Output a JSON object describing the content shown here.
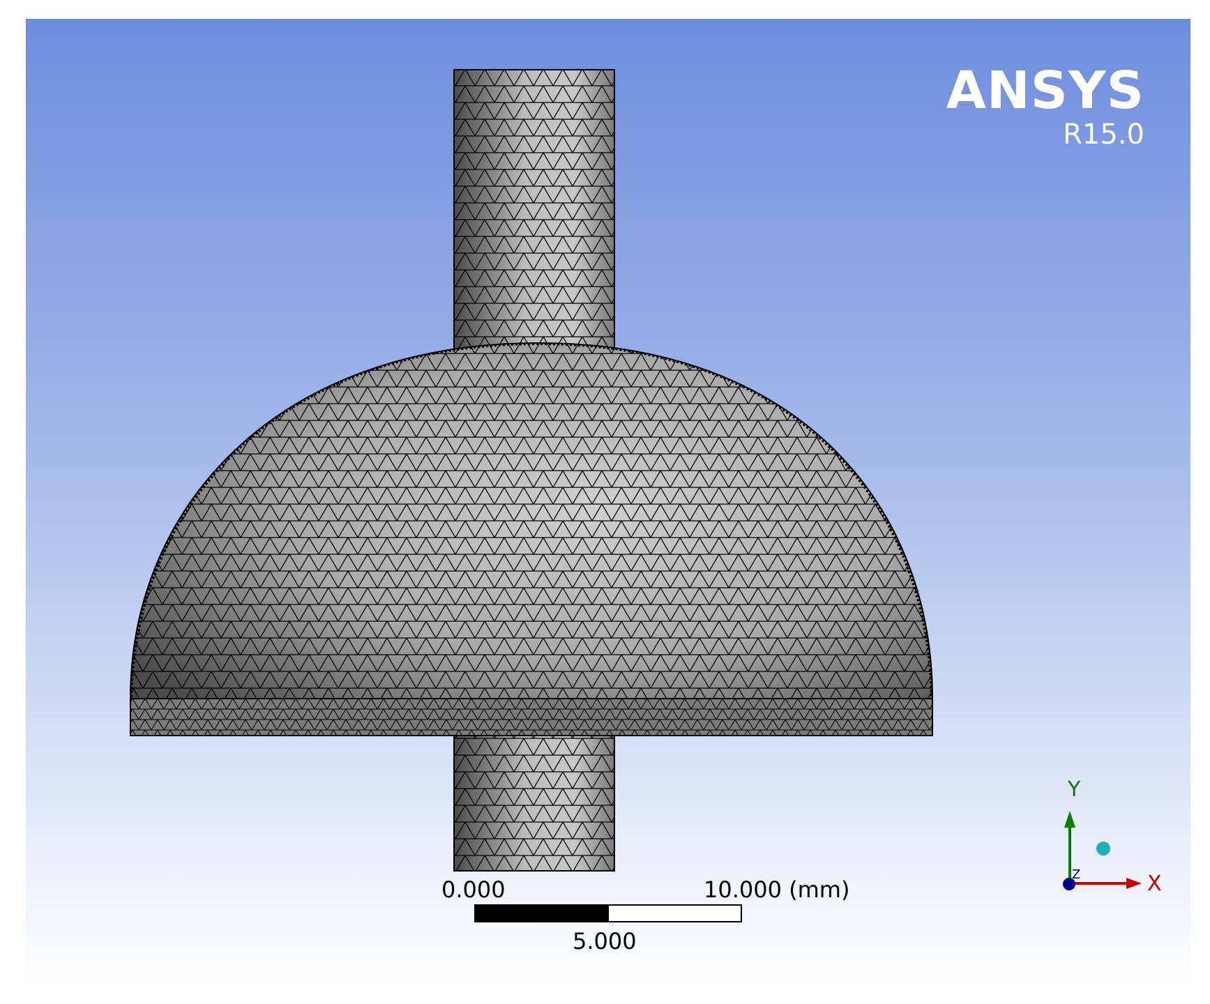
{
  "logo": {
    "name": "ANSYS",
    "version": "R15.0"
  },
  "scale_bar": {
    "left_label": "0.000",
    "right_label": "10.000 (mm)",
    "mid_label": "5.000"
  },
  "triad": {
    "y_label": "Y",
    "x_label": "X",
    "z_label": "Z"
  },
  "colors": {
    "x_axis": "#cc0000",
    "y_axis": "#008000",
    "z_axis": "#00008b",
    "iso_ball": "#20b0b8",
    "mesh_line": "#000000"
  }
}
